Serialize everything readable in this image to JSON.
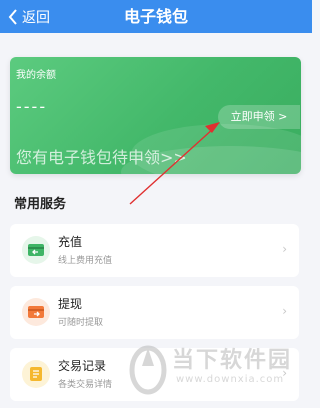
{
  "header": {
    "back_label": "返回",
    "title": "电子钱包"
  },
  "card": {
    "balance_label": "我的余额",
    "balance_value": "----",
    "apply_button": "立即申领 >",
    "pending_text": "您有电子钱包待申领>>"
  },
  "section": {
    "title": "常用服务"
  },
  "services": [
    {
      "name": "充值",
      "desc": "线上费用充值",
      "icon": "recharge-icon"
    },
    {
      "name": "提现",
      "desc": "可随时提取",
      "icon": "withdraw-icon"
    },
    {
      "name": "交易记录",
      "desc": "各类交易详情",
      "icon": "transaction-record-icon"
    }
  ],
  "watermark": {
    "chinese": "当下软件园",
    "url": "www.downxia.com"
  },
  "colors": {
    "header": "#3a8dee",
    "card_green": "#4cbf72",
    "annotation_red": "#e03030"
  }
}
